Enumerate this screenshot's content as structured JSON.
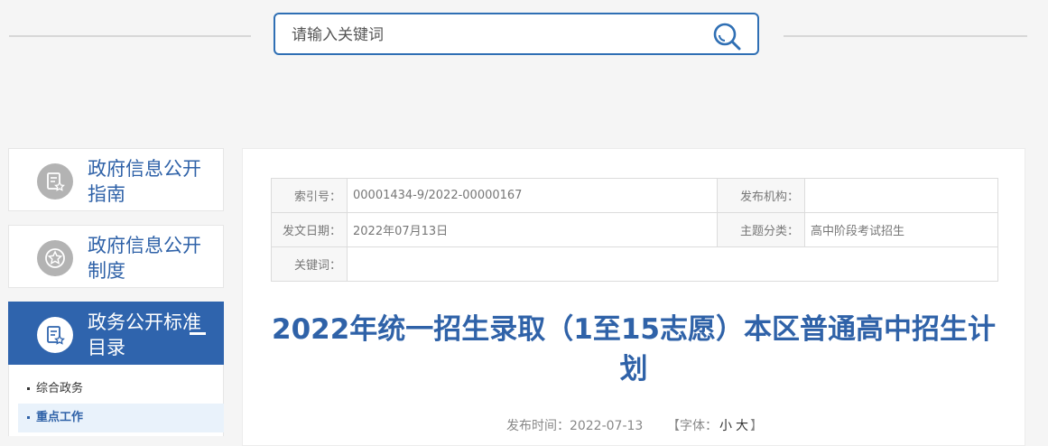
{
  "search": {
    "placeholder": "请输入关键词"
  },
  "sidebar": {
    "items": [
      {
        "label": "政府信息公开指南"
      },
      {
        "label": "政府信息公开制度"
      },
      {
        "label": "政务公开标准目录"
      }
    ],
    "submenu": [
      {
        "label": "综合政务"
      },
      {
        "label": "重点工作"
      }
    ]
  },
  "meta": {
    "index_label": "索引号：",
    "index_value": "00001434-9/2022-00000167",
    "org_label": "发布机构：",
    "org_value": "",
    "date_label": "发文日期：",
    "date_value": "2022年07月13日",
    "topic_label": "主题分类：",
    "topic_value": "高中阶段考试招生",
    "keyword_label": "关键词：",
    "keyword_value": ""
  },
  "article": {
    "title": "2022年统一招生录取（1至15志愿）本区普通高中招生计划",
    "publish_label": "发布时间：",
    "publish_time": "2022-07-13",
    "font_open": "【字体：",
    "font_small": "小",
    "font_large": "大",
    "font_close": "】"
  },
  "colors": {
    "accent": "#2f62a8",
    "active_bg": "#2f64ad"
  }
}
